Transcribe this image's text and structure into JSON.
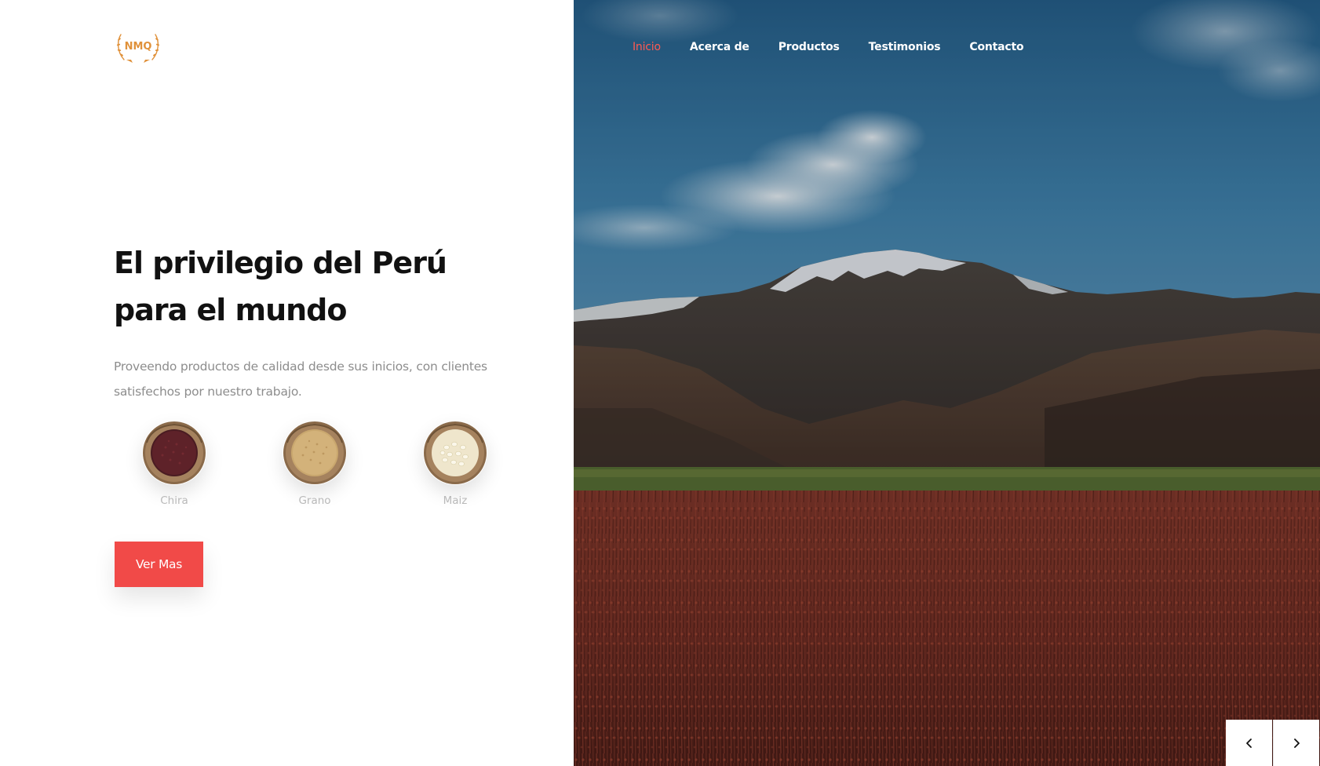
{
  "brand": {
    "logo_text": "NMQ",
    "logo_color": "#e0913a"
  },
  "nav": {
    "items": [
      {
        "label": "Inicio",
        "active": true
      },
      {
        "label": "Acerca de",
        "active": false
      },
      {
        "label": "Productos",
        "active": false
      },
      {
        "label": "Testimonios",
        "active": false
      },
      {
        "label": "Contacto",
        "active": false
      }
    ],
    "active_color": "#ff5a52"
  },
  "hero": {
    "headline_line1": "El privilegio del Perú",
    "headline_line2": "para el mundo",
    "lead_line1": "Proveendo productos de calidad desde sus inicios, con clientes",
    "lead_line2": "satisfechos por nuestro trabajo."
  },
  "products": [
    {
      "label": "Chira",
      "icon": "red-quinoa-bowl-icon"
    },
    {
      "label": "Grano",
      "icon": "grain-bowl-icon"
    },
    {
      "label": "Maiz",
      "icon": "white-corn-bowl-icon"
    }
  ],
  "cta": {
    "label": "Ver Mas",
    "color": "#f14a48"
  },
  "slider": {
    "prev_icon": "chevron-left-icon",
    "next_icon": "chevron-right-icon"
  }
}
